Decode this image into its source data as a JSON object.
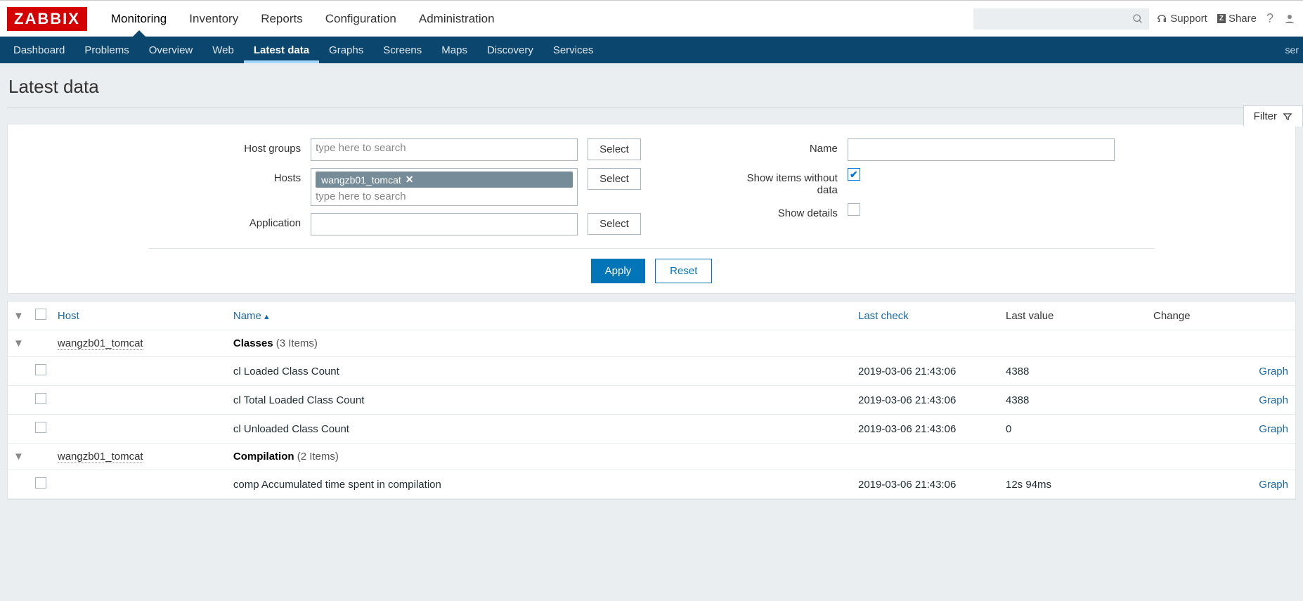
{
  "logo": "ZABBIX",
  "topnav": [
    "Monitoring",
    "Inventory",
    "Reports",
    "Configuration",
    "Administration"
  ],
  "topnav_active": 0,
  "top_right": {
    "support": "Support",
    "share": "Share"
  },
  "subnav": [
    "Dashboard",
    "Problems",
    "Overview",
    "Web",
    "Latest data",
    "Graphs",
    "Screens",
    "Maps",
    "Discovery",
    "Services"
  ],
  "subnav_active": 4,
  "subnav_right": "ser",
  "page_title": "Latest data",
  "filter_tab": "Filter",
  "filters": {
    "host_groups": {
      "label": "Host groups",
      "placeholder": "type here to search",
      "select": "Select"
    },
    "hosts": {
      "label": "Hosts",
      "tag": "wangzb01_tomcat",
      "placeholder": "type here to search",
      "select": "Select"
    },
    "application": {
      "label": "Application",
      "select": "Select"
    },
    "name": {
      "label": "Name"
    },
    "show_no_data": {
      "label": "Show items without data",
      "checked": true
    },
    "show_details": {
      "label": "Show details",
      "checked": false
    },
    "apply": "Apply",
    "reset": "Reset"
  },
  "columns": {
    "host": "Host",
    "name": "Name",
    "last_check": "Last check",
    "last_value": "Last value",
    "change": "Change"
  },
  "groups": [
    {
      "host": "wangzb01_tomcat",
      "app": "Classes",
      "count": "(3 Items)",
      "rows": [
        {
          "name": "cl Loaded Class Count",
          "last": "2019-03-06 21:43:06",
          "value": "4388",
          "graph": "Graph"
        },
        {
          "name": "cl Total Loaded Class Count",
          "last": "2019-03-06 21:43:06",
          "value": "4388",
          "graph": "Graph"
        },
        {
          "name": "cl Unloaded Class Count",
          "last": "2019-03-06 21:43:06",
          "value": "0",
          "graph": "Graph"
        }
      ]
    },
    {
      "host": "wangzb01_tomcat",
      "app": "Compilation",
      "count": "(2 Items)",
      "rows": [
        {
          "name": "comp Accumulated time spent in compilation",
          "last": "2019-03-06 21:43:06",
          "value": "12s 94ms",
          "graph": "Graph"
        }
      ]
    }
  ]
}
